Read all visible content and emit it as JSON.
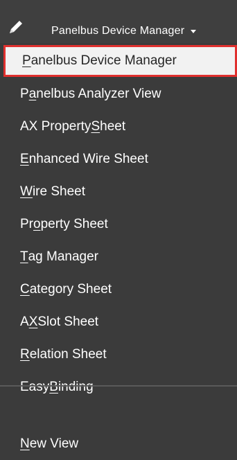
{
  "toolbar": {
    "edit_icon": "pencil-icon",
    "selector_label": "Panelbus Device Manager",
    "selector_icon": "caret-down-icon"
  },
  "menu": {
    "items": [
      {
        "pre": "",
        "key": "P",
        "post": "anelbus Device Manager",
        "selected": true
      },
      {
        "pre": "P",
        "key": "a",
        "post": "nelbus Analyzer View"
      },
      {
        "pre": "AX Property ",
        "key": "S",
        "post": "heet"
      },
      {
        "pre": "",
        "key": "E",
        "post": "nhanced Wire Sheet"
      },
      {
        "pre": "",
        "key": "W",
        "post": "ire Sheet"
      },
      {
        "pre": "Pr",
        "key": "o",
        "post": "perty Sheet"
      },
      {
        "pre": "",
        "key": "T",
        "post": "ag Manager"
      },
      {
        "pre": "",
        "key": "C",
        "post": "ategory Sheet"
      },
      {
        "pre": "A",
        "key": "X",
        "post": " Slot Sheet"
      },
      {
        "pre": "",
        "key": "R",
        "post": "elation Sheet"
      },
      {
        "pre": "Easy ",
        "key": "B",
        "post": "inding"
      },
      {
        "pre": "",
        "key": "N",
        "post": "ew View"
      }
    ]
  }
}
